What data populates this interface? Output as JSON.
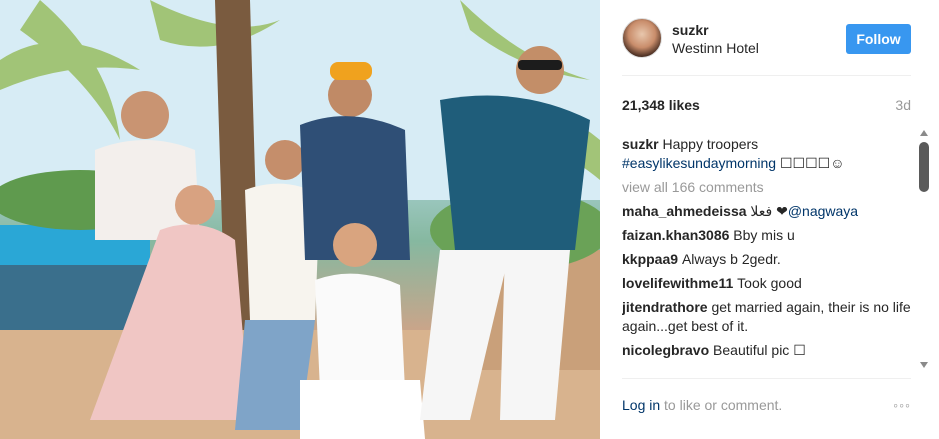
{
  "post": {
    "username": "suzkr",
    "location": "Westinn Hotel",
    "follow_label": "Follow",
    "likes": "21,348 likes",
    "age": "3d"
  },
  "caption": {
    "user": "suzkr",
    "text": "Happy troopers",
    "hashtag": "#easylikesundaymorning",
    "emoji": "☐☐☐☐☺"
  },
  "view_all": "view all 166 comments",
  "comments": [
    {
      "user": "maha_ahmedeissa",
      "text": "فعلا ❤",
      "mention": "@nagwaya"
    },
    {
      "user": "faizan.khan3086",
      "text": "Bby mis u"
    },
    {
      "user": "kkppaa9",
      "text": "Always b 2gedr."
    },
    {
      "user": "lovelifewithme11",
      "text": "Took good"
    },
    {
      "user": "jitendrathore",
      "text": "get married again, their is no life again...get best of it."
    },
    {
      "user": "nicolegbravo",
      "text": "Beautiful pic ☐"
    }
  ],
  "footer": {
    "login_link": "Log in",
    "login_rest": "to like or comment.",
    "more": "◦◦◦"
  },
  "colors": {
    "follow_button": "#3897f0",
    "link": "#003569",
    "muted": "#999999"
  }
}
